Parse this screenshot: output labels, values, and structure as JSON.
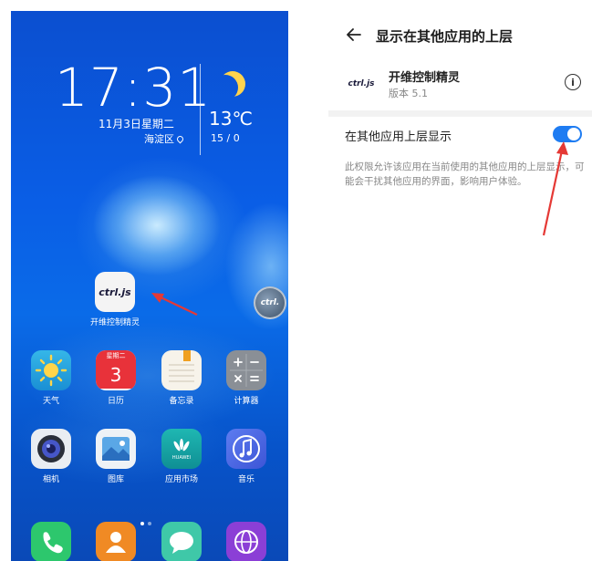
{
  "home": {
    "clock": "17:31",
    "date": "11月3日星期二",
    "district": "海淀区",
    "weather": {
      "temperature": "13℃",
      "aqi": "15 / 0",
      "icon": "moon-icon"
    },
    "featured_app": {
      "label": "开维控制精灵",
      "logo_text": "ctrl.js"
    },
    "floating_button": {
      "logo_text": "ctrl."
    },
    "calendar_icon": {
      "weekday": "星期二",
      "day": "3"
    },
    "appstore_icon": {
      "brand": "HUAWEI"
    },
    "apps": [
      {
        "label": "天气"
      },
      {
        "label": "日历"
      },
      {
        "label": "备忘录"
      },
      {
        "label": "计算器"
      },
      {
        "label": "相机"
      },
      {
        "label": "图库"
      },
      {
        "label": "应用市场"
      },
      {
        "label": "音乐"
      }
    ],
    "page_indicator": {
      "current": 1,
      "total": 2
    }
  },
  "settings": {
    "title": "显示在其他应用的上层",
    "app_name": "开维控制精灵",
    "app_version": "版本 5.1",
    "app_logo_text": "ctrl.js",
    "permission_label": "在其他应用上层显示",
    "permission_enabled": true,
    "permission_description": "此权限允许该应用在当前使用的其他应用的上层显示，可能会干扰其他应用的界面，影响用户体验。"
  },
  "colors": {
    "toggle_on": "#1e7cf2",
    "annotation_arrow": "#e53935",
    "wallpaper_blue": "#0a5ee6"
  }
}
